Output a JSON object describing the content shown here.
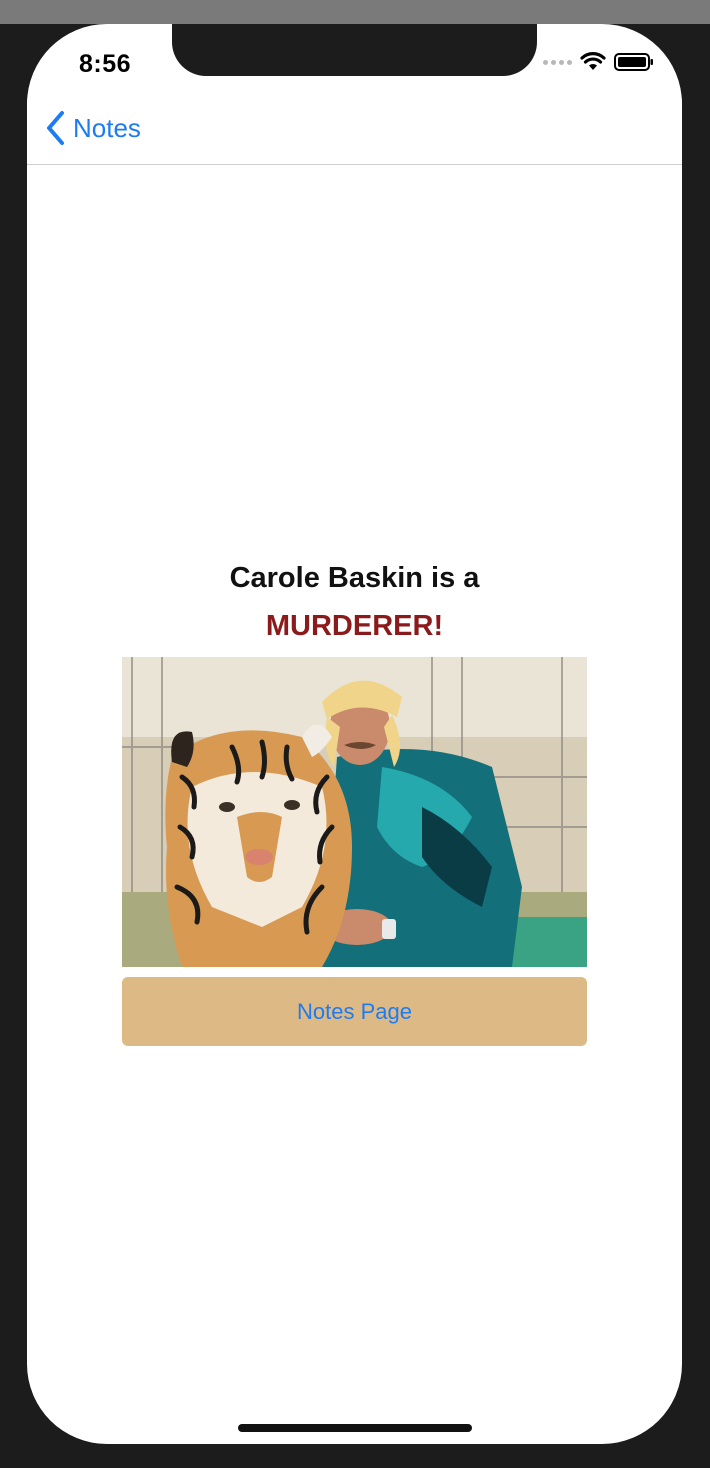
{
  "status_bar": {
    "time": "8:56"
  },
  "nav": {
    "back_label": "Notes"
  },
  "main": {
    "headline": "Carole Baskin is a",
    "highlight": "MURDERER!",
    "button_label": "Notes Page"
  },
  "colors": {
    "accent": "#1d7cf2",
    "highlight": "#8b1a1a",
    "button_bg": "#ddb985"
  }
}
